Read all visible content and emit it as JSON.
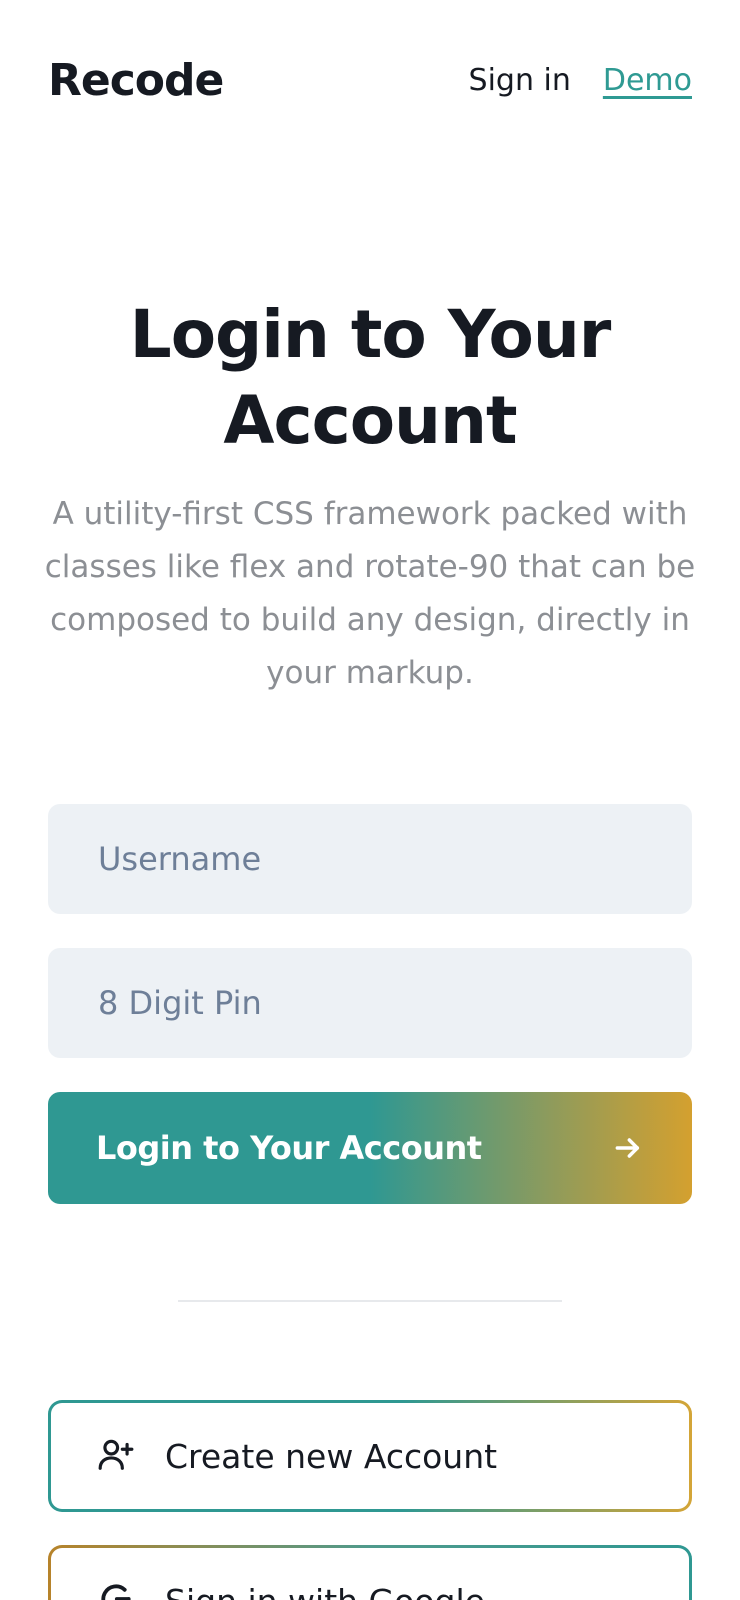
{
  "header": {
    "brand": "Recode",
    "nav": {
      "signin": "Sign in",
      "demo": "Demo"
    }
  },
  "hero": {
    "title": "Login to Your Account",
    "subtitle": "A utility-first CSS framework packed with classes like flex and rotate-90 that can be composed to build any design, directly in your markup."
  },
  "form": {
    "username": {
      "placeholder": "Username",
      "value": ""
    },
    "pin": {
      "placeholder": "8 Digit Pin",
      "value": ""
    },
    "submit_label": "Login to Your Account",
    "submit_icon": "arrow-right-icon"
  },
  "alt_actions": {
    "create": {
      "label": "Create new Account",
      "icon": "user-plus-icon"
    },
    "google": {
      "label": "Sign in with Google",
      "icon": "google-icon"
    }
  },
  "colors": {
    "accent_teal": "#2f9892",
    "accent_gold": "#d4a02f",
    "link": "#2f9a93",
    "input_bg": "#edf1f5",
    "muted_text": "#8c8f94"
  }
}
